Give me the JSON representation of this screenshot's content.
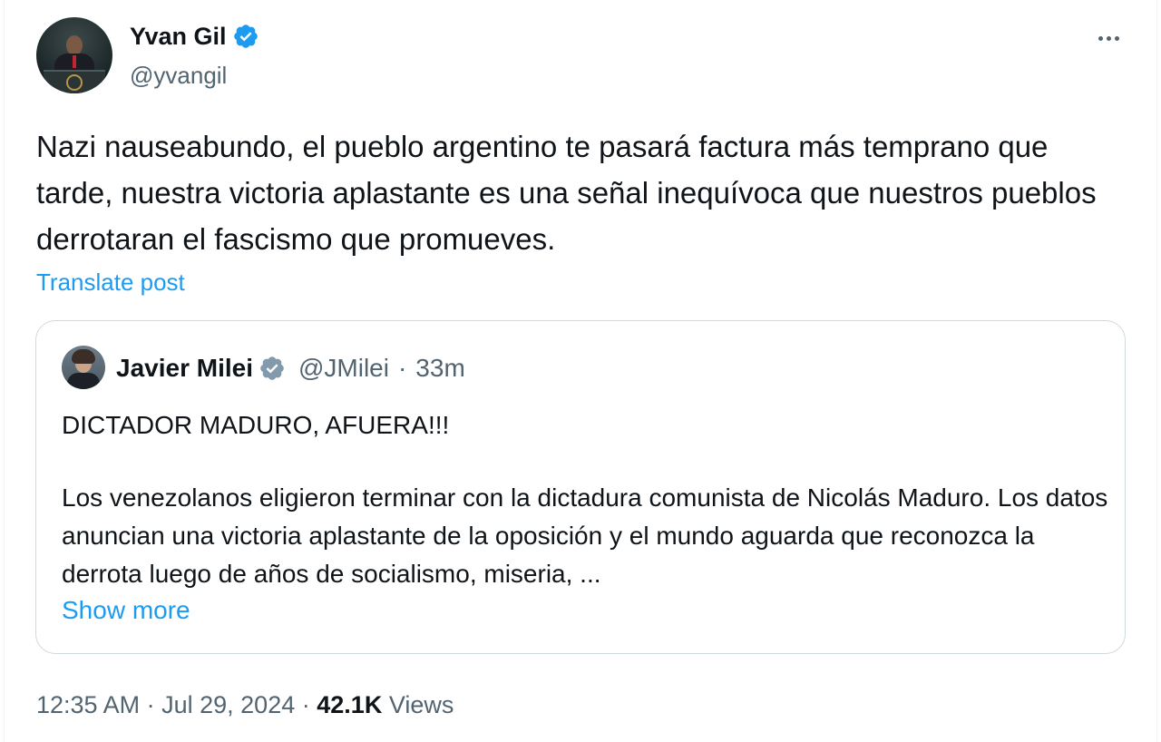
{
  "author": {
    "display_name": "Yvan Gil",
    "handle": "@yvangil",
    "verified": true,
    "verified_color": "#1d9bf0"
  },
  "tweet": {
    "text": "Nazi nauseabundo, el pueblo argentino te pasará factura más temprano que tarde, nuestra victoria aplastante es una señal inequívoca que nuestros pueblos derrotaran el fascismo que promueves.",
    "translate_label": "Translate post"
  },
  "quoted": {
    "display_name": "Javier Milei",
    "handle": "@JMilei",
    "separator": "·",
    "time": "33m",
    "verified_color": "#829aab",
    "line1": "DICTADOR MADURO, AFUERA!!!",
    "body": "Los venezolanos eligieron terminar con la dictadura comunista de Nicolás Maduro. Los datos anuncian una victoria aplastante de la oposición y el mundo aguarda que reconozca la derrota luego de años de socialismo, miseria, ...",
    "show_more": "Show more"
  },
  "meta": {
    "time": "12:35 AM",
    "sep1": "·",
    "date": "Jul 29, 2024",
    "sep2": "·",
    "views_count": "42.1K",
    "views_label": "Views"
  },
  "icons": {
    "more": "more-horizontal-icon",
    "verified": "verified-badge-icon"
  },
  "colors": {
    "link": "#1d9bf0",
    "text": "#0f1419",
    "secondary": "#536471",
    "border": "#cfd9de"
  }
}
